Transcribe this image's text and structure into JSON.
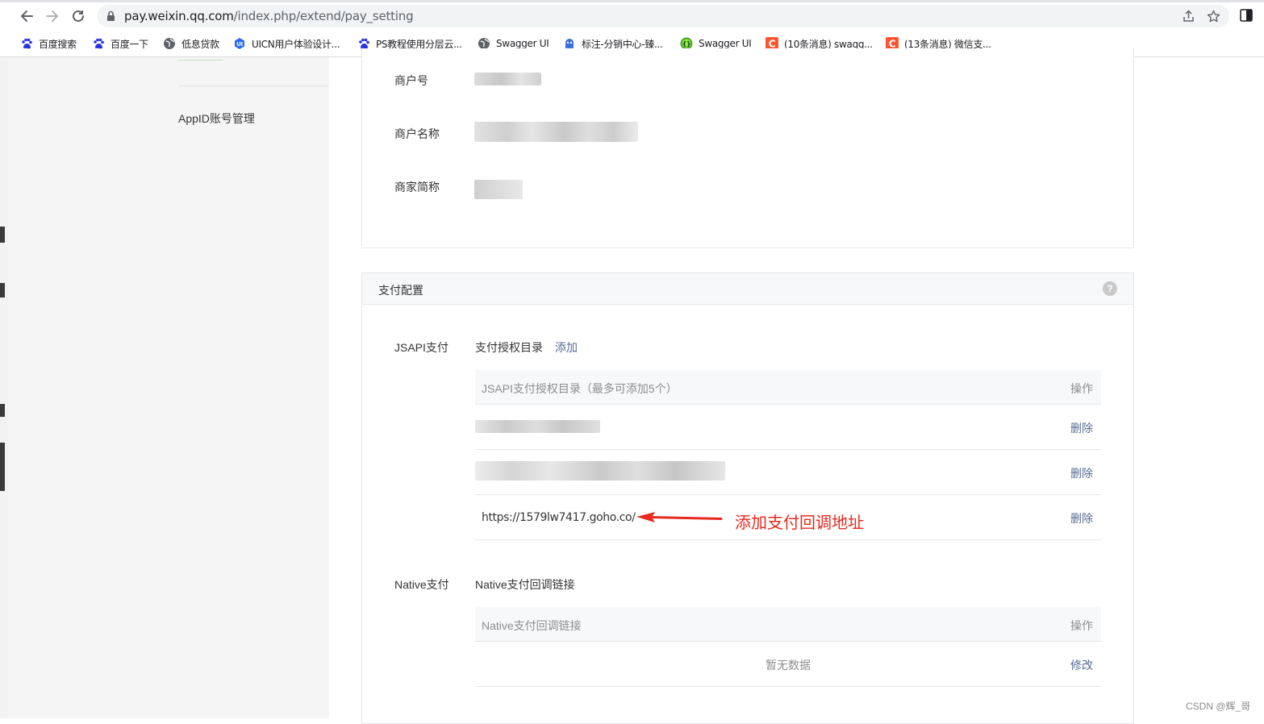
{
  "browser": {
    "url_host": "pay.weixin.qq.com",
    "url_path": "/index.php/extend/pay_setting",
    "bookmarks": [
      {
        "label": "百度搜索",
        "icon": "baidu-paw-icon"
      },
      {
        "label": "百度一下",
        "icon": "baidu-paw-icon"
      },
      {
        "label": "低息贷款",
        "icon": "globe-icon"
      },
      {
        "label": "UICN用户体验设计...",
        "icon": "ui-badge-icon"
      },
      {
        "label": "PS教程使用分层云...",
        "icon": "baidu-paw-icon"
      },
      {
        "label": "Swagger UI",
        "icon": "globe-icon"
      },
      {
        "label": "标注-分销中心-臻...",
        "icon": "ghost-icon"
      },
      {
        "label": "Swagger UI",
        "icon": "swagger-icon"
      },
      {
        "label": "(10条消息) swagg...",
        "icon": "csdn-icon"
      },
      {
        "label": "(13条消息) 微信支...",
        "icon": "csdn-icon"
      }
    ]
  },
  "sidebar": {
    "nav_item": "AppID账号管理"
  },
  "merchant_info": {
    "merchant_id_label": "商户号",
    "merchant_name_label": "商户名称",
    "merchant_short_label": "商家简称"
  },
  "pay_config": {
    "title": "支付配置",
    "help": "?",
    "jsapi": {
      "label": "JSAPI支付",
      "dir_label": "支付授权目录",
      "add_label": "添加",
      "col_dir": "JSAPI支付授权目录（最多可添加5个）",
      "col_op": "操作",
      "rows": [
        {
          "value": "",
          "op": "删除"
        },
        {
          "value": "",
          "op": "删除"
        },
        {
          "value": "https://1579lw7417.goho.co/",
          "op": "删除"
        }
      ]
    },
    "native": {
      "label": "Native支付",
      "callback_label": "Native支付回调链接",
      "col_link": "Native支付回调链接",
      "col_op": "操作",
      "empty": "暂无数据",
      "modify": "修改"
    }
  },
  "annotation": {
    "text": "添加支付回调地址",
    "color": "#e8291e"
  },
  "watermark": "CSDN @辉_哥",
  "colors": {
    "link": "#576b95",
    "sidebar_bg": "#f5f5f5",
    "header_bg": "#f6f8f9"
  }
}
